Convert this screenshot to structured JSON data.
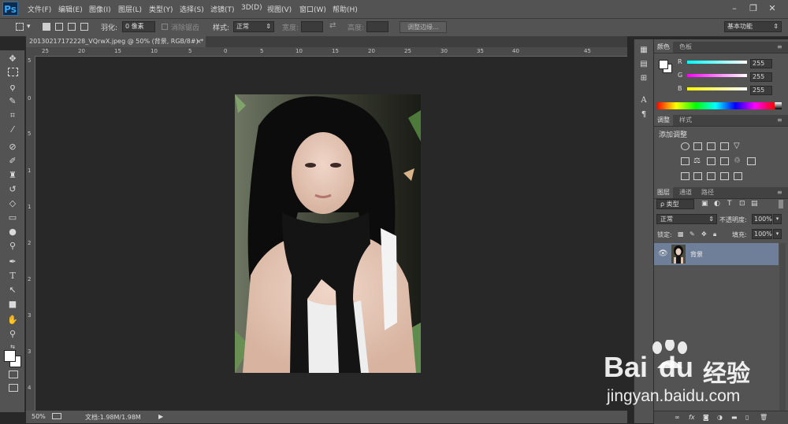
{
  "app": {
    "logo": "Ps"
  },
  "menu": [
    "文件(F)",
    "编辑(E)",
    "图像(I)",
    "图层(L)",
    "类型(Y)",
    "选择(S)",
    "滤镜(T)",
    "3D(D)",
    "视图(V)",
    "窗口(W)",
    "帮助(H)"
  ],
  "options": {
    "feather_label": "羽化:",
    "feather_value": "0 像素",
    "antialias_label": "消除锯齿",
    "style_label": "样式:",
    "style_value": "正常",
    "width_label": "宽度:",
    "height_label": "高度:",
    "refine_edge": "调整边缘...",
    "workspace": "基本功能"
  },
  "document": {
    "tab_title": "20130217172228_VQrwX.jpeg @ 50% (背景, RGB/8#) *",
    "tab_close": "×",
    "zoom": "50%",
    "doc_size": "文档:1.98M/1.98M"
  },
  "ruler": {
    "h_ticks": [
      "25",
      "20",
      "15",
      "10",
      "5",
      "0",
      "5",
      "10",
      "15",
      "20",
      "25",
      "30",
      "35",
      "40",
      "45"
    ],
    "v_ticks": [
      "5",
      "0",
      "5",
      "1",
      "1",
      "2",
      "2",
      "3",
      "3",
      "4"
    ]
  },
  "color_panel": {
    "tabs": [
      "颜色",
      "色板"
    ],
    "channels": [
      {
        "name": "R",
        "value": "255",
        "color": "#00ffff"
      },
      {
        "name": "G",
        "value": "255",
        "color": "#ff00ff"
      },
      {
        "name": "B",
        "value": "255",
        "color": "#ffff00"
      }
    ]
  },
  "adjust_panel": {
    "tabs": [
      "调整",
      "样式"
    ],
    "title": "添加调整"
  },
  "layers_panel": {
    "tabs": [
      "图层",
      "通道",
      "路径"
    ],
    "filter_label": "ρ 类型",
    "blend_mode": "正常",
    "opacity_label": "不透明度:",
    "opacity_value": "100%",
    "lock_label": "锁定:",
    "fill_label": "填充:",
    "fill_value": "100%",
    "layers": [
      {
        "name": "背景"
      }
    ],
    "bottom_icons": [
      "link-icon",
      "fx-icon",
      "mask-icon",
      "adjustment-icon",
      "folder-icon",
      "new-layer-icon",
      "trash-icon"
    ]
  },
  "watermark": {
    "brand_a": "Bai",
    "brand_b": "du",
    "brand_cn": "经验",
    "url": "jingyan.baidu.com"
  }
}
